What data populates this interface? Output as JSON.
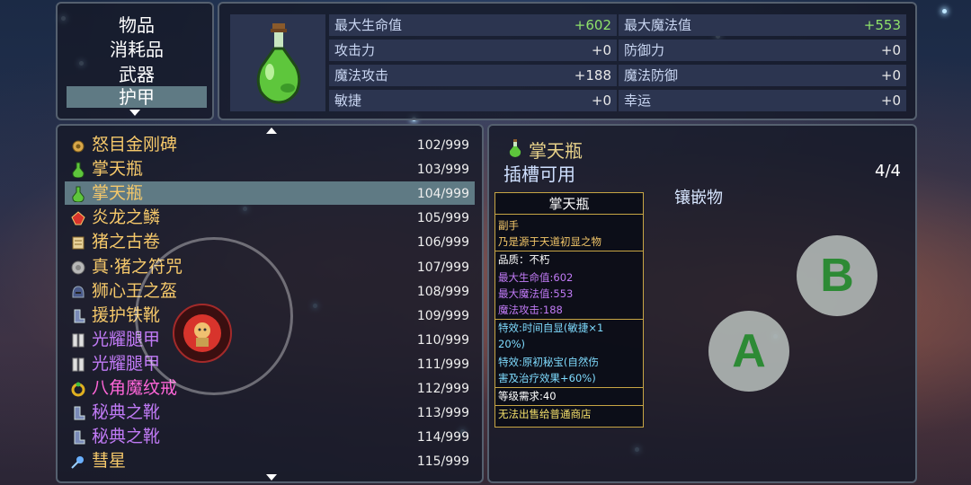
{
  "categories": {
    "items": [
      "物品",
      "消耗品",
      "武器",
      "护甲"
    ],
    "selected": "护甲"
  },
  "stats": [
    {
      "label": "最大生命值",
      "value": "+602",
      "color": "green"
    },
    {
      "label": "最大魔法值",
      "value": "+553",
      "color": "green"
    },
    {
      "label": "攻击力",
      "value": "+0",
      "color": "white"
    },
    {
      "label": "防御力",
      "value": "+0",
      "color": "white"
    },
    {
      "label": "魔法攻击",
      "value": "+188",
      "color": "white"
    },
    {
      "label": "魔法防御",
      "value": "+0",
      "color": "white"
    },
    {
      "label": "敏捷",
      "value": "+0",
      "color": "white"
    },
    {
      "label": "幸运",
      "value": "+0",
      "color": "white"
    }
  ],
  "item_list": [
    {
      "name": "怒目金刚碑",
      "count": "102/999",
      "color": "#f5c86a",
      "icon": "amulet-icon"
    },
    {
      "name": "掌天瓶",
      "count": "103/999",
      "color": "#f5c86a",
      "icon": "potion-icon"
    },
    {
      "name": "掌天瓶",
      "count": "104/999",
      "color": "#f5c86a",
      "icon": "potion-icon"
    },
    {
      "name": "炎龙之鳞",
      "count": "105/999",
      "color": "#f5c86a",
      "icon": "scale-icon"
    },
    {
      "name": "猪之古卷",
      "count": "106/999",
      "color": "#f5c86a",
      "icon": "scroll-icon"
    },
    {
      "name": "真·猪之符咒",
      "count": "107/999",
      "color": "#f5c86a",
      "icon": "charm-icon"
    },
    {
      "name": "狮心王之盔",
      "count": "108/999",
      "color": "#f5c86a",
      "icon": "helmet-icon"
    },
    {
      "name": "援护铁靴",
      "count": "109/999",
      "color": "#f5c86a",
      "icon": "boots-icon"
    },
    {
      "name": "光耀腿甲",
      "count": "110/999",
      "color": "#c07af5",
      "icon": "greaves-icon"
    },
    {
      "name": "光耀腿甲",
      "count": "111/999",
      "color": "#c07af5",
      "icon": "greaves-icon"
    },
    {
      "name": "八角魔纹戒",
      "count": "112/999",
      "color": "#ff66d9",
      "icon": "ring-icon"
    },
    {
      "name": "秘典之靴",
      "count": "113/999",
      "color": "#c07af5",
      "icon": "boots-icon"
    },
    {
      "name": "秘典之靴",
      "count": "114/999",
      "color": "#c07af5",
      "icon": "boots-icon"
    },
    {
      "name": "彗星",
      "count": "115/999",
      "color": "#f5c86a",
      "icon": "comet-icon"
    }
  ],
  "selected_index": 2,
  "detail": {
    "title": "掌天瓶",
    "subtitle": "插槽可用",
    "slots": "4/4",
    "gem_label": "镶嵌物"
  },
  "card": {
    "title": "掌天瓶",
    "lines": [
      {
        "text": "副手",
        "cls": "gold"
      },
      {
        "text": "乃是源于天道初显之物",
        "cls": "gold"
      },
      {
        "text": "品质：不朽",
        "cls": "white"
      },
      {
        "text": "最大生命值:602",
        "cls": "purple"
      },
      {
        "text": "最大魔法值:553",
        "cls": "purple"
      },
      {
        "text": "魔法攻击:188",
        "cls": "purple"
      },
      {
        "text": "特效:时间自显(敏捷×1",
        "cls": "cyan"
      },
      {
        "text": "20%)",
        "cls": "cyan"
      },
      {
        "text": "特效:原初秘宝(自然伤",
        "cls": "cyan"
      },
      {
        "text": "害及治疗效果+60%)",
        "cls": "cyan"
      },
      {
        "text": "等级需求:40",
        "cls": "white"
      },
      {
        "text": "无法出售给普通商店",
        "cls": "yellow"
      }
    ]
  },
  "buttons": {
    "a": "A",
    "b": "B"
  },
  "colors": {
    "selection": "#5f7a84",
    "panel_border": "#55606f",
    "card_border": "#c7a544"
  }
}
